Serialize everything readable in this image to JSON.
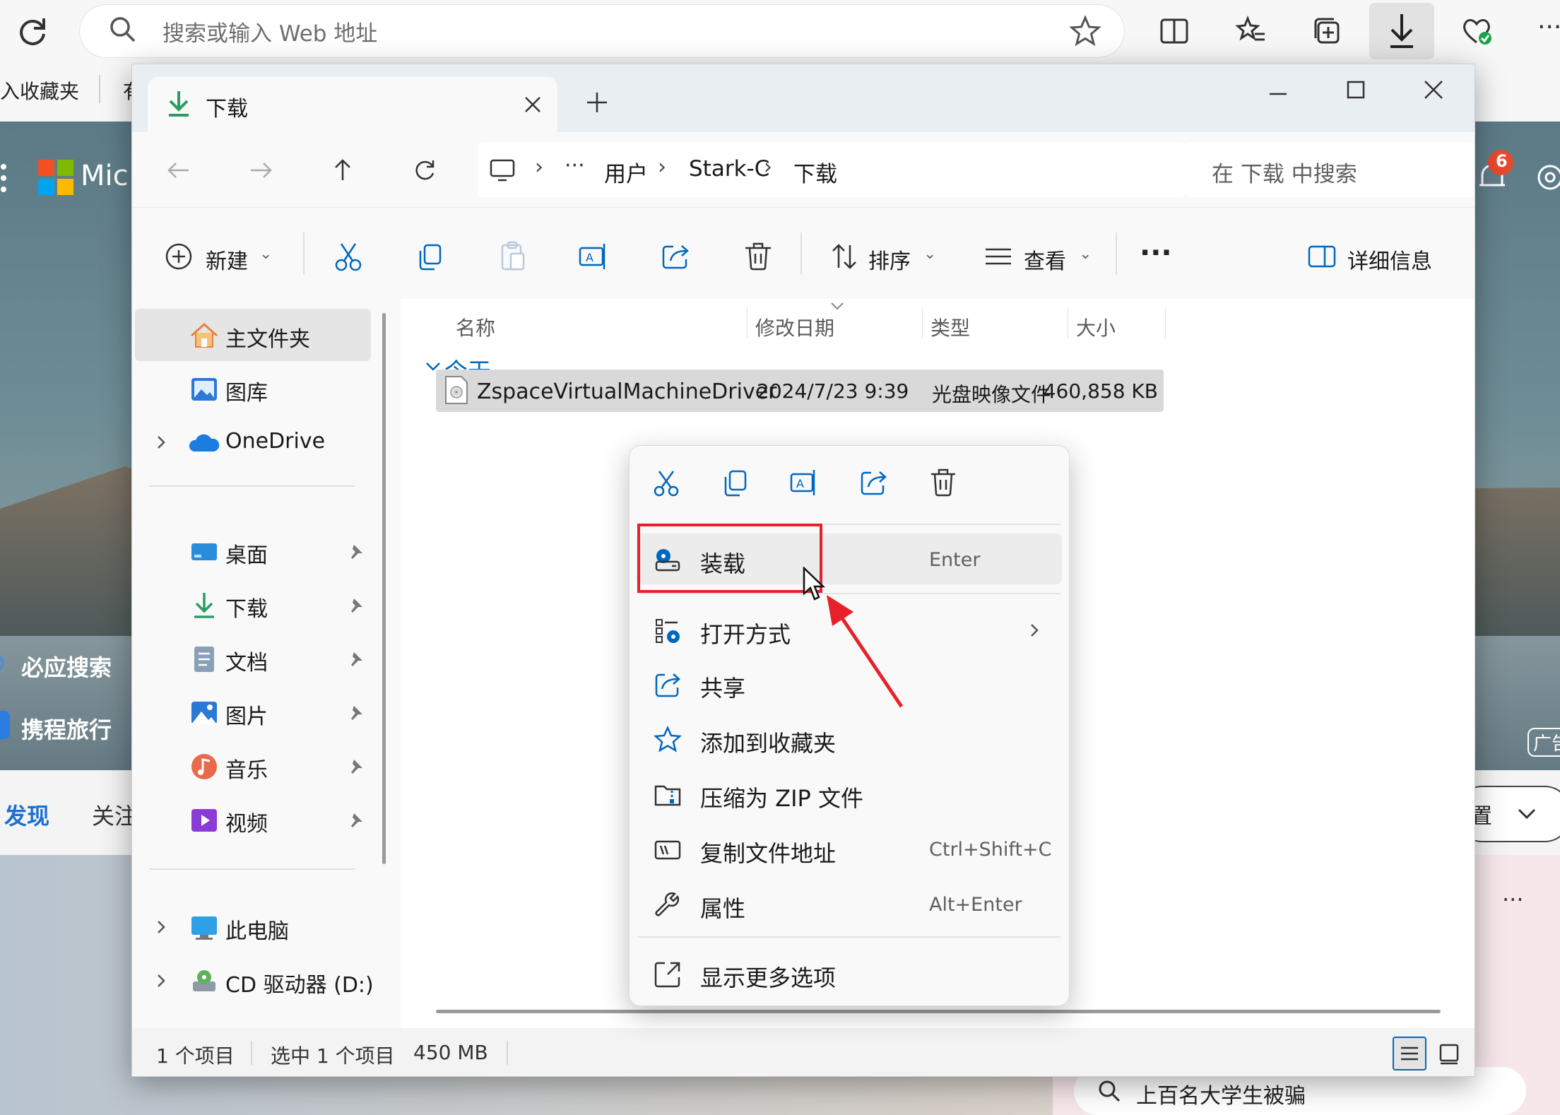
{
  "browser": {
    "address_placeholder": "搜索或输入 Web 地址",
    "favbar_item": "入收藏夹",
    "favbar_item2": "有"
  },
  "background_page": {
    "logo_text": "Mic",
    "left_links": [
      "必应搜索",
      "携程旅行"
    ],
    "tabs": [
      "发现",
      "关注"
    ],
    "notification_count": "6",
    "right_partial": "置",
    "ad_label": "广告",
    "search_hint": "上百名大学生被骗",
    "more": "···"
  },
  "window": {
    "tab_title": "下载",
    "breadcrumb": [
      "用户",
      "Stark-C",
      "下载"
    ],
    "breadcrumb_more": "···",
    "search_placeholder": "在 下载 中搜索",
    "toolbar": {
      "new_label": "新建",
      "sort_label": "排序",
      "view_label": "查看",
      "more_label": "···",
      "details_label": "详细信息"
    },
    "sidebar": {
      "home": "主文件夹",
      "gallery": "图库",
      "onedrive": "OneDrive",
      "quick": [
        "桌面",
        "下载",
        "文档",
        "图片",
        "音乐",
        "视频"
      ],
      "this_pc": "此电脑",
      "cd_drive": "CD 驱动器 (D:)"
    },
    "columns": {
      "name": "名称",
      "modified": "修改日期",
      "type": "类型",
      "size": "大小"
    },
    "group_header": "今天",
    "file": {
      "name": "ZspaceVirtualMachineDriver",
      "modified": "2024/7/23 9:39",
      "type": "光盘映像文件",
      "size": "460,858 KB"
    },
    "status": {
      "count": "1 个项目",
      "selected": "选中 1 个项目",
      "size": "450 MB"
    }
  },
  "context_menu": {
    "items": [
      {
        "label": "装载",
        "shortcut": "Enter"
      },
      {
        "label": "打开方式",
        "shortcut": ""
      },
      {
        "label": "共享",
        "shortcut": ""
      },
      {
        "label": "添加到收藏夹",
        "shortcut": ""
      },
      {
        "label": "压缩为 ZIP 文件",
        "shortcut": ""
      },
      {
        "label": "复制文件地址",
        "shortcut": "Ctrl+Shift+C"
      },
      {
        "label": "属性",
        "shortcut": "Alt+Enter"
      },
      {
        "label": "显示更多选项",
        "shortcut": ""
      }
    ],
    "highlight_color": "#e8202a",
    "arrow_color": "#e8202a"
  },
  "colors": {
    "accent": "#0067c0",
    "download_green": "#2a9d62"
  }
}
